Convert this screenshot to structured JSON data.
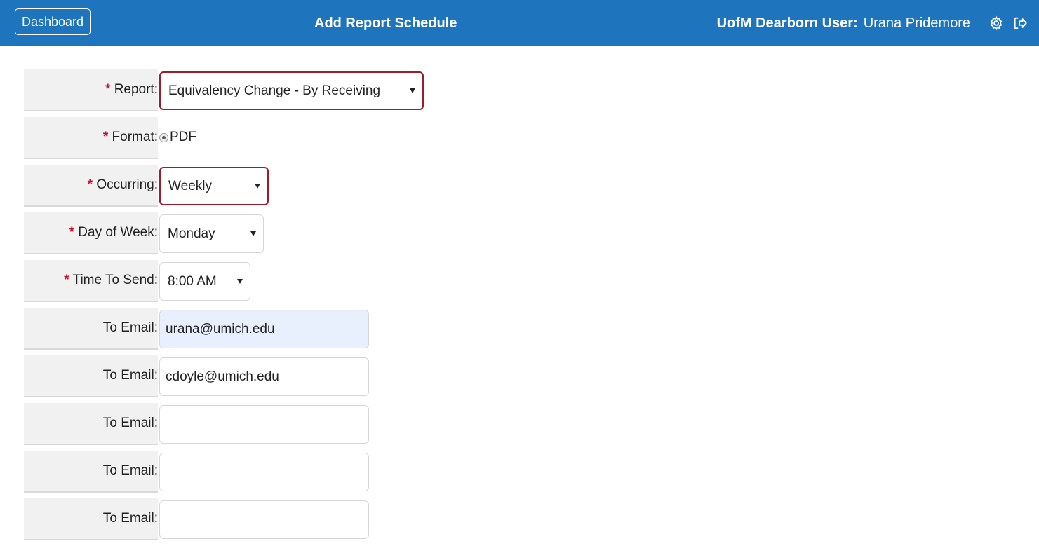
{
  "header": {
    "dashboard_label": "Dashboard",
    "title": "Add Report Schedule",
    "user_label": "UofM Dearborn User:",
    "user_name": "Urana Pridemore",
    "icons": [
      "gear-icon",
      "logout-icon"
    ],
    "background_color": "#1f75bd"
  },
  "form": {
    "required_marker": "*",
    "report": {
      "label": "Report:",
      "value": "Equivalency Change - By Receiving"
    },
    "format": {
      "label": "Format:",
      "option": "PDF",
      "selected": true
    },
    "occurring": {
      "label": "Occurring:",
      "value": "Weekly"
    },
    "day_of_week": {
      "label": "Day of Week:",
      "value": "Monday"
    },
    "time_to_send": {
      "label": "Time To Send:",
      "value": "8:00 AM"
    },
    "emails": [
      {
        "label": "To Email:",
        "value": "urana@umich.edu"
      },
      {
        "label": "To Email:",
        "value": "cdoyle@umich.edu"
      },
      {
        "label": "To Email:",
        "value": ""
      },
      {
        "label": "To Email:",
        "value": ""
      },
      {
        "label": "To Email:",
        "value": ""
      }
    ]
  },
  "colors": {
    "required": "#c8102e",
    "invalid_border": "#9b1c2c",
    "autofill_bg": "#e8f0fe"
  }
}
